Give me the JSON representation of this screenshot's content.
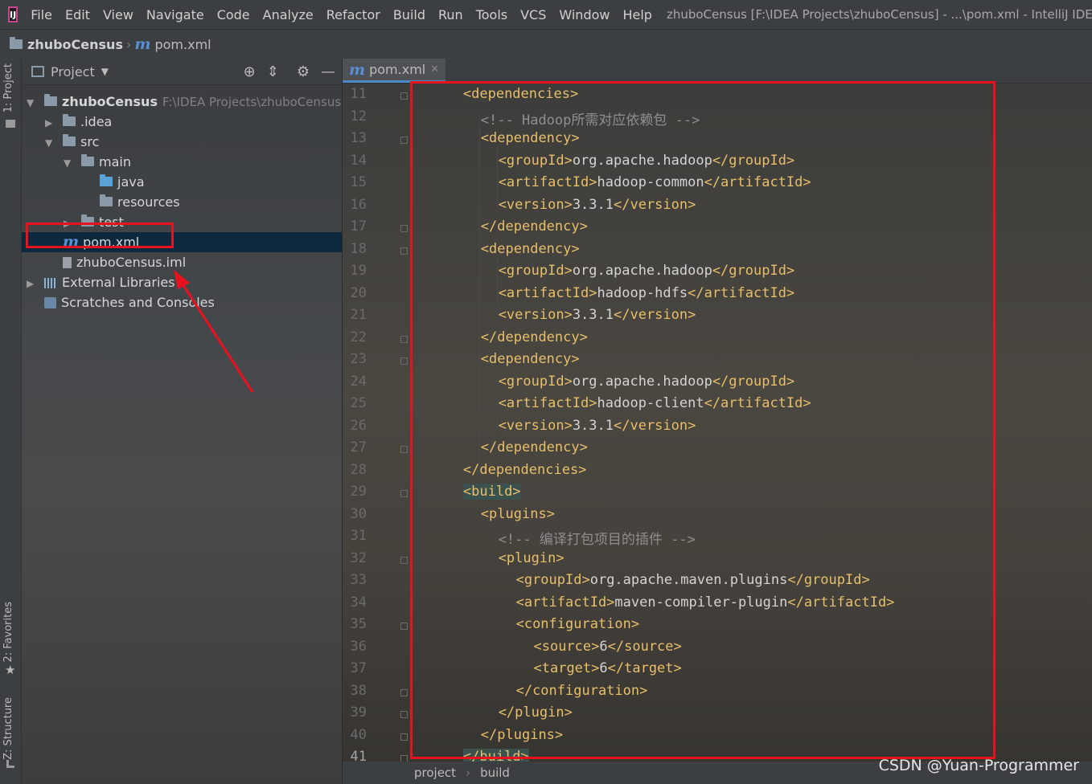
{
  "app": {
    "window_title": "zhuboCensus [F:\\IDEA Projects\\zhuboCensus] - ...\\pom.xml - IntelliJ IDEA",
    "menu": [
      "File",
      "Edit",
      "View",
      "Navigate",
      "Code",
      "Analyze",
      "Refactor",
      "Build",
      "Run",
      "Tools",
      "VCS",
      "Window",
      "Help"
    ]
  },
  "navbar": {
    "project": "zhuboCensus",
    "file": "pom.xml"
  },
  "left_strip": {
    "project_tab": "1: Project",
    "favorites_tab": "2: Favorites",
    "structure_tab": "Z: Structure"
  },
  "project_panel": {
    "title": "Project",
    "tree": [
      {
        "label": "zhuboCensus",
        "path": "F:\\IDEA Projects\\zhuboCensus",
        "indent": 0,
        "arrow": "down",
        "icon": "folder-icon"
      },
      {
        "label": ".idea",
        "indent": 1,
        "arrow": "right",
        "icon": "folder-icon"
      },
      {
        "label": "src",
        "indent": 1,
        "arrow": "down",
        "icon": "folder-icon"
      },
      {
        "label": "main",
        "indent": 2,
        "arrow": "down",
        "icon": "folder-icon"
      },
      {
        "label": "java",
        "indent": 3,
        "arrow": "",
        "icon": "source-folder-icon"
      },
      {
        "label": "resources",
        "indent": 3,
        "arrow": "",
        "icon": "resources-folder-icon"
      },
      {
        "label": "test",
        "indent": 2,
        "arrow": "right",
        "icon": "folder-icon"
      },
      {
        "label": "pom.xml",
        "indent": 1,
        "arrow": "",
        "icon": "maven-icon",
        "selected": true
      },
      {
        "label": "zhuboCensus.iml",
        "indent": 1,
        "arrow": "",
        "icon": "iml-file-icon"
      },
      {
        "label": "External Libraries",
        "indent": 0,
        "arrow": "right",
        "icon": "libraries-icon"
      },
      {
        "label": "Scratches and Consoles",
        "indent": 0,
        "arrow": "",
        "icon": "scratches-icon"
      }
    ]
  },
  "editor": {
    "tab_label": "pom.xml",
    "lines": [
      {
        "n": "11",
        "indent": 2,
        "parts": [
          [
            "tag",
            "<dependencies>"
          ]
        ]
      },
      {
        "n": "12",
        "indent": 4,
        "parts": [
          [
            "cmt",
            "<!-- Hadoop所需对应依赖包 -->"
          ]
        ]
      },
      {
        "n": "13",
        "indent": 4,
        "parts": [
          [
            "tag",
            "<dependency>"
          ]
        ]
      },
      {
        "n": "14",
        "indent": 6,
        "parts": [
          [
            "tag",
            "<groupId>"
          ],
          [
            "txt",
            "org.apache.hadoop"
          ],
          [
            "tag",
            "</groupId>"
          ]
        ]
      },
      {
        "n": "15",
        "indent": 6,
        "parts": [
          [
            "tag",
            "<artifactId>"
          ],
          [
            "txt",
            "hadoop-common"
          ],
          [
            "tag",
            "</artifactId>"
          ]
        ]
      },
      {
        "n": "16",
        "indent": 6,
        "parts": [
          [
            "tag",
            "<version>"
          ],
          [
            "txt",
            "3.3.1"
          ],
          [
            "tag",
            "</version>"
          ]
        ]
      },
      {
        "n": "17",
        "indent": 4,
        "parts": [
          [
            "tag",
            "</dependency>"
          ]
        ]
      },
      {
        "n": "18",
        "indent": 4,
        "parts": [
          [
            "tag",
            "<dependency>"
          ]
        ]
      },
      {
        "n": "19",
        "indent": 6,
        "parts": [
          [
            "tag",
            "<groupId>"
          ],
          [
            "txt",
            "org.apache.hadoop"
          ],
          [
            "tag",
            "</groupId>"
          ]
        ]
      },
      {
        "n": "20",
        "indent": 6,
        "parts": [
          [
            "tag",
            "<artifactId>"
          ],
          [
            "txt",
            "hadoop-hdfs"
          ],
          [
            "tag",
            "</artifactId>"
          ]
        ]
      },
      {
        "n": "21",
        "indent": 6,
        "parts": [
          [
            "tag",
            "<version>"
          ],
          [
            "txt",
            "3.3.1"
          ],
          [
            "tag",
            "</version>"
          ]
        ]
      },
      {
        "n": "22",
        "indent": 4,
        "parts": [
          [
            "tag",
            "</dependency>"
          ]
        ]
      },
      {
        "n": "23",
        "indent": 4,
        "parts": [
          [
            "tag",
            "<dependency>"
          ]
        ]
      },
      {
        "n": "24",
        "indent": 6,
        "parts": [
          [
            "tag",
            "<groupId>"
          ],
          [
            "txt",
            "org.apache.hadoop"
          ],
          [
            "tag",
            "</groupId>"
          ]
        ]
      },
      {
        "n": "25",
        "indent": 6,
        "parts": [
          [
            "tag",
            "<artifactId>"
          ],
          [
            "txt",
            "hadoop-client"
          ],
          [
            "tag",
            "</artifactId>"
          ]
        ]
      },
      {
        "n": "26",
        "indent": 6,
        "parts": [
          [
            "tag",
            "<version>"
          ],
          [
            "txt",
            "3.3.1"
          ],
          [
            "tag",
            "</version>"
          ]
        ]
      },
      {
        "n": "27",
        "indent": 4,
        "parts": [
          [
            "tag",
            "</dependency>"
          ]
        ]
      },
      {
        "n": "28",
        "indent": 2,
        "parts": [
          [
            "tag",
            "</dependencies>"
          ]
        ]
      },
      {
        "n": "29",
        "indent": 2,
        "parts": [
          [
            "tag",
            "<build>"
          ]
        ],
        "highlight": true
      },
      {
        "n": "30",
        "indent": 4,
        "parts": [
          [
            "tag",
            "<plugins>"
          ]
        ]
      },
      {
        "n": "31",
        "indent": 6,
        "parts": [
          [
            "cmt",
            "<!-- 编译打包项目的插件 -->"
          ]
        ]
      },
      {
        "n": "32",
        "indent": 6,
        "parts": [
          [
            "tag",
            "<plugin>"
          ]
        ]
      },
      {
        "n": "33",
        "indent": 8,
        "parts": [
          [
            "tag",
            "<groupId>"
          ],
          [
            "txt",
            "org.apache.maven.plugins"
          ],
          [
            "tag",
            "</groupId>"
          ]
        ]
      },
      {
        "n": "34",
        "indent": 8,
        "parts": [
          [
            "tag",
            "<artifactId>"
          ],
          [
            "txt",
            "maven-compiler-plugin"
          ],
          [
            "tag",
            "</artifactId>"
          ]
        ]
      },
      {
        "n": "35",
        "indent": 8,
        "parts": [
          [
            "tag",
            "<configuration>"
          ]
        ]
      },
      {
        "n": "36",
        "indent": 10,
        "parts": [
          [
            "tag",
            "<source>"
          ],
          [
            "txt",
            "6"
          ],
          [
            "tag",
            "</source>"
          ]
        ]
      },
      {
        "n": "37",
        "indent": 10,
        "parts": [
          [
            "tag",
            "<target>"
          ],
          [
            "txt",
            "6"
          ],
          [
            "tag",
            "</target>"
          ]
        ]
      },
      {
        "n": "38",
        "indent": 8,
        "parts": [
          [
            "tag",
            "</configuration>"
          ]
        ]
      },
      {
        "n": "39",
        "indent": 6,
        "parts": [
          [
            "tag",
            "</plugin>"
          ]
        ]
      },
      {
        "n": "40",
        "indent": 4,
        "parts": [
          [
            "tag",
            "</plugins>"
          ]
        ]
      },
      {
        "n": "41",
        "indent": 2,
        "parts": [
          [
            "tag",
            "</build>"
          ]
        ],
        "highlight": true,
        "current": true
      }
    ]
  },
  "breadcrumbs": [
    "project",
    "build"
  ],
  "watermark": "CSDN @Yuan-Programmer",
  "colors": {
    "annotation": "#e8121f",
    "xml_tag": "#e8bf6a",
    "selection": "#0d293e"
  }
}
